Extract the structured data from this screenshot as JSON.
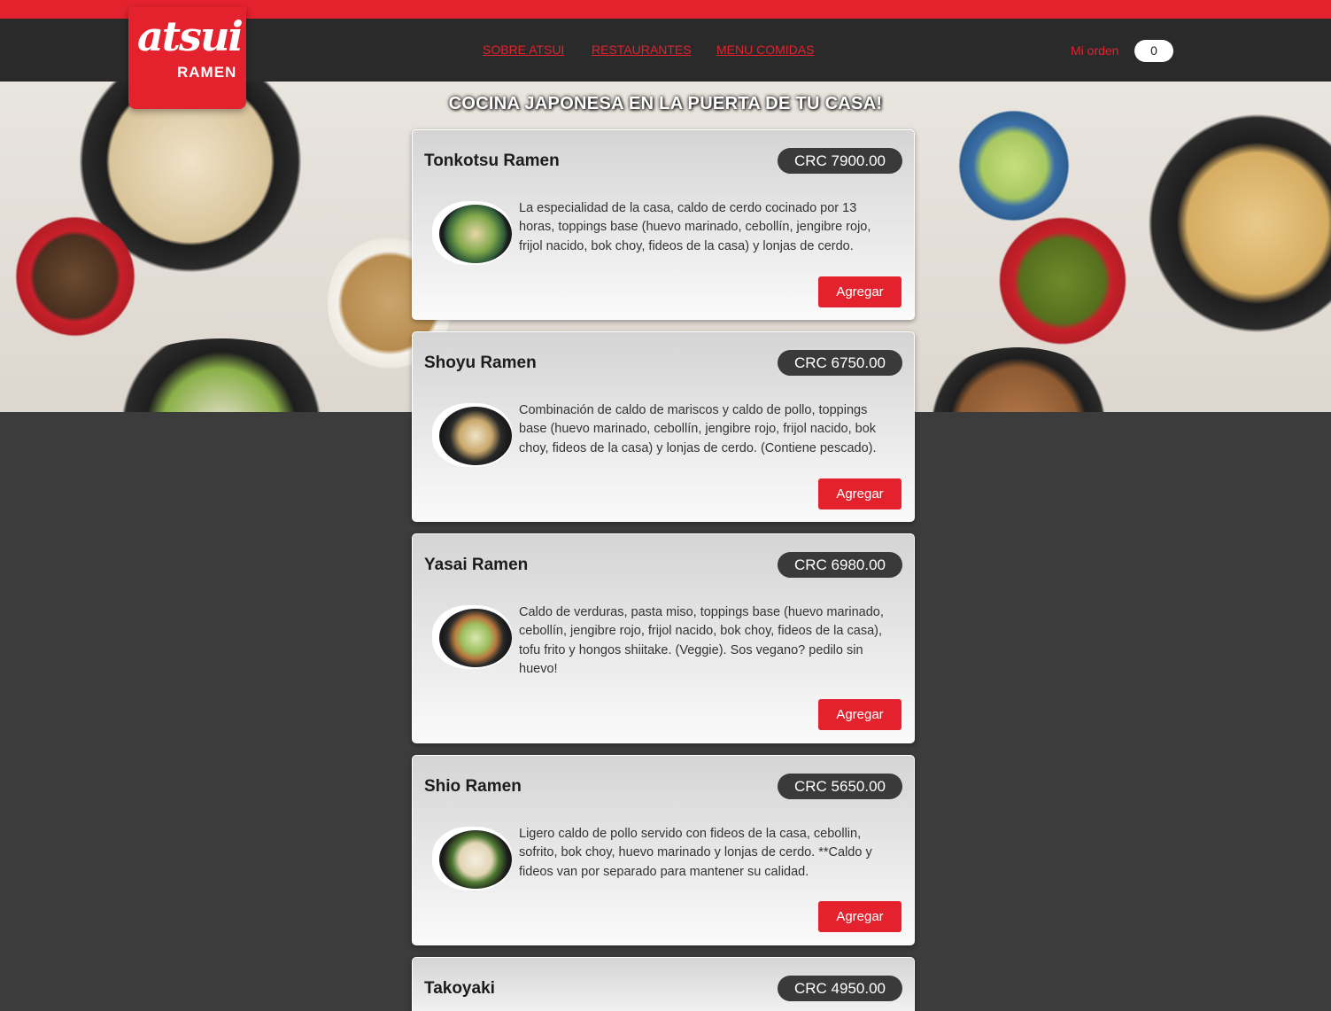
{
  "brand": {
    "logo_main": "atsui",
    "logo_sub": "RAMEN"
  },
  "nav": {
    "items": [
      "SOBRE ATSUI",
      "RESTAURANTES",
      "MENU COMIDAS"
    ]
  },
  "order": {
    "label": "Mi orden",
    "count": "0"
  },
  "hero": {
    "title": "COCINA JAPONESA EN LA PUERTA DE TU CASA!"
  },
  "menu": [
    {
      "name": "Tonkotsu Ramen",
      "price": "CRC 7900.00",
      "description": "La especialidad de la casa, caldo de cerdo cocinado por 13 horas, toppings base (huevo marinado, cebollín, jengibre rojo, frijol nacido, bok choy, fideos de la casa) y lonjas de cerdo.",
      "button": "Agregar"
    },
    {
      "name": "Shoyu Ramen",
      "price": "CRC 6750.00",
      "description": "Combinación de caldo de mariscos y caldo de pollo, toppings base (huevo marinado, cebollín, jengibre rojo, frijol nacido, bok choy, fideos de la casa) y lonjas de cerdo. (Contiene pescado).",
      "button": "Agregar"
    },
    {
      "name": "Yasai Ramen",
      "price": "CRC 6980.00",
      "description": "Caldo de verduras, pasta miso, toppings base (huevo marinado, cebollín, jengibre rojo, frijol nacido, bok choy, fideos de la casa), tofu frito y hongos shiitake. (Veggie). Sos vegano? pedilo sin huevo!",
      "button": "Agregar"
    },
    {
      "name": "Shio Ramen",
      "price": "CRC 5650.00",
      "description": "Ligero caldo de pollo servido con fideos de la casa, cebollin, sofrito, bok choy, huevo marinado y lonjas de cerdo. **Caldo y fideos van por separado para mantener su calidad.",
      "button": "Agregar"
    },
    {
      "name": "Takoyaki",
      "price": "CRC 4950.00"
    }
  ],
  "colors": {
    "accent": "#e3222e",
    "header": "#2a2a2a",
    "page_bg": "#3c3c3c",
    "price_pill": "#3a3a3a"
  }
}
